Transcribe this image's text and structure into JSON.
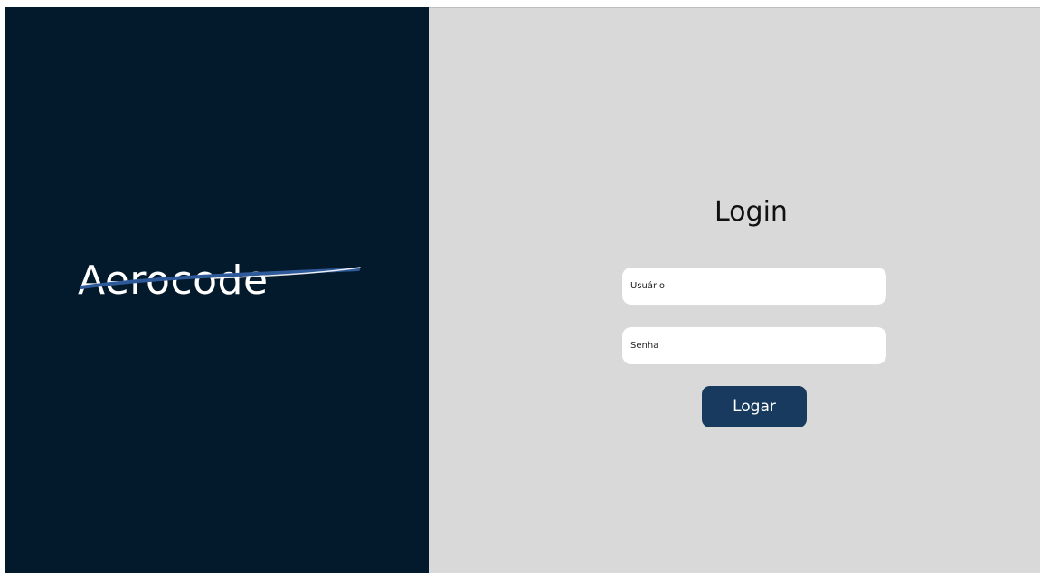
{
  "brand": {
    "logo_text": "Aerocode",
    "panel_color": "#03192c",
    "swoosh_color": "#2e5a9a"
  },
  "login": {
    "title": "Login",
    "username_placeholder": "Usuário",
    "password_placeholder": "Senha",
    "submit_label": "Logar",
    "button_color": "#173a5e",
    "panel_color": "#d9d9d9"
  }
}
